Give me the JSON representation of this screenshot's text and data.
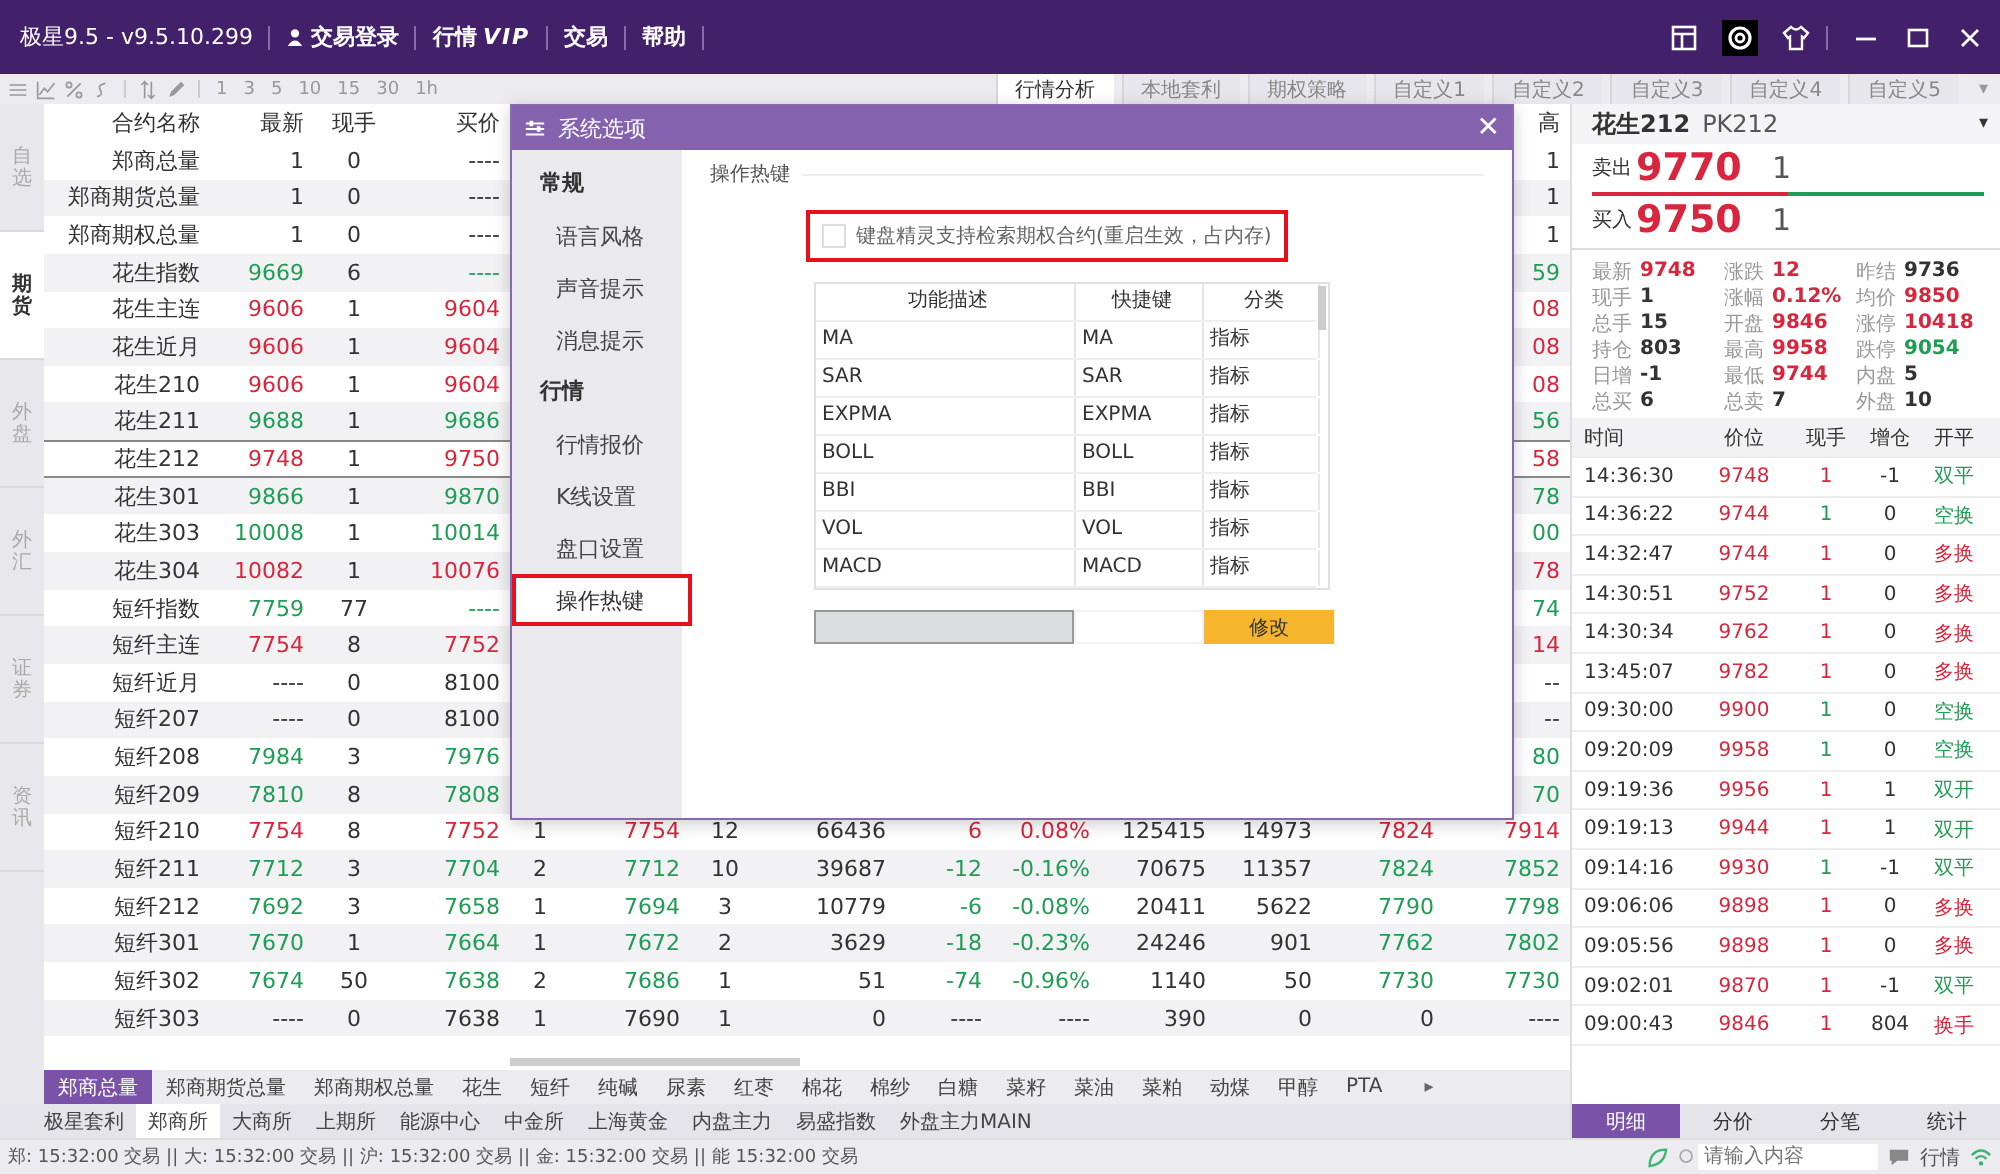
{
  "window": {
    "title": "极星9.5 - v9.5.10.299"
  },
  "menu": [
    {
      "label": "交易登录",
      "kind": "user"
    },
    {
      "label": "行情",
      "badge": "VIP",
      "kind": "vip"
    },
    {
      "label": "交易",
      "kind": "plain"
    },
    {
      "label": "帮助",
      "kind": "plain"
    }
  ],
  "toolbar": {
    "periods": [
      "1",
      "3",
      "5",
      "10",
      "15",
      "30",
      "1h"
    ],
    "tabs": [
      {
        "label": "行情分析",
        "selected": true
      },
      {
        "label": "本地套利",
        "selected": false
      },
      {
        "label": "期权策略",
        "selected": false
      },
      {
        "label": "自定义1",
        "selected": false
      },
      {
        "label": "自定义2",
        "selected": false
      },
      {
        "label": "自定义3",
        "selected": false
      },
      {
        "label": "自定义4",
        "selected": false
      },
      {
        "label": "自定义5",
        "selected": false
      }
    ],
    "more": "▾"
  },
  "side_tabs": [
    {
      "label": "自选",
      "selected": false
    },
    {
      "label": "期货",
      "selected": true
    },
    {
      "label": "外盘",
      "selected": false
    },
    {
      "label": "外汇",
      "selected": false
    },
    {
      "label": "证券",
      "selected": false
    },
    {
      "label": "资讯",
      "selected": false
    }
  ],
  "quote_table": {
    "columns": [
      "合约名称",
      "最新",
      "现手",
      "买价"
    ],
    "column_14": "高",
    "rows": [
      {
        "name": "郑商总量",
        "last": "1",
        "vol": "0",
        "bid": "----",
        "selected": false,
        "edge": "1"
      },
      {
        "name": "郑商期货总量",
        "last": "1",
        "vol": "0",
        "bid": "----",
        "selected": false,
        "edge": "1"
      },
      {
        "name": "郑商期权总量",
        "last": "1",
        "vol": "0",
        "bid": "----",
        "selected": false,
        "edge": "1"
      },
      {
        "name": "花生指数",
        "last": "9669",
        "vol": "6",
        "bid": "----",
        "color": "#1f9d55",
        "selected": false,
        "edge": "59"
      },
      {
        "name": "花生主连",
        "last": "9606",
        "vol": "1",
        "bid": "9604",
        "color": "#d7263d",
        "selected": false,
        "edge": "08"
      },
      {
        "name": "花生近月",
        "last": "9606",
        "vol": "1",
        "bid": "9604",
        "color": "#d7263d",
        "selected": false,
        "edge": "08"
      },
      {
        "name": "花生210",
        "last": "9606",
        "vol": "1",
        "bid": "9604",
        "color": "#d7263d",
        "selected": false,
        "edge": "08"
      },
      {
        "name": "花生211",
        "last": "9688",
        "vol": "1",
        "bid": "9686",
        "color": "#1f9d55",
        "selected": false,
        "edge": "56"
      },
      {
        "name": "花生212",
        "last": "9748",
        "vol": "1",
        "bid": "9750",
        "color": "#d7263d",
        "selected": true,
        "edge": "58"
      },
      {
        "name": "花生301",
        "last": "9866",
        "vol": "1",
        "bid": "9870",
        "color": "#1f9d55",
        "selected": false,
        "edge": "78"
      },
      {
        "name": "花生303",
        "last": "10008",
        "vol": "1",
        "bid": "10014",
        "color": "#1f9d55",
        "selected": false,
        "edge": "00"
      },
      {
        "name": "花生304",
        "last": "10082",
        "vol": "1",
        "bid": "10076",
        "color": "#d7263d",
        "selected": false,
        "edge": "78"
      },
      {
        "name": "短纤指数",
        "last": "7759",
        "vol": "77",
        "bid": "----",
        "color": "#1f9d55",
        "selected": false,
        "edge": "74"
      },
      {
        "name": "短纤主连",
        "last": "7754",
        "vol": "8",
        "bid": "7752",
        "color": "#d7263d",
        "selected": false,
        "edge": "14"
      },
      {
        "name": "短纤近月",
        "last": "----",
        "vol": "0",
        "bid": "8100",
        "selected": false,
        "edge": "--"
      },
      {
        "name": "短纤207",
        "last": "----",
        "vol": "0",
        "bid": "8100",
        "selected": false,
        "edge": "--"
      },
      {
        "name": "短纤208",
        "last": "7984",
        "vol": "3",
        "bid": "7976",
        "color": "#1f9d55",
        "selected": false,
        "edge": "80"
      },
      {
        "name": "短纤209",
        "last": "7810",
        "vol": "8",
        "bid": "7808",
        "color": "#1f9d55",
        "selected": false,
        "edge": "70"
      },
      {
        "name": "短纤210",
        "last": "7754",
        "vol": "8",
        "bid": "7752",
        "color": "#d7263d",
        "selected": false,
        "rest": [
          "1",
          "7754",
          "12",
          "66436",
          "6",
          "0.08%",
          "125415",
          "14973",
          "7824",
          "7914"
        ]
      },
      {
        "name": "短纤211",
        "last": "7712",
        "vol": "3",
        "bid": "7704",
        "color": "#1f9d55",
        "selected": false,
        "rest": [
          "2",
          "7712",
          "10",
          "39687",
          "-12",
          "-0.16%",
          "70675",
          "11357",
          "7824",
          "7852"
        ]
      },
      {
        "name": "短纤212",
        "last": "7692",
        "vol": "3",
        "bid": "7658",
        "color": "#1f9d55",
        "selected": false,
        "rest": [
          "1",
          "7694",
          "3",
          "10779",
          "-6",
          "-0.08%",
          "20411",
          "5622",
          "7790",
          "7798"
        ]
      },
      {
        "name": "短纤301",
        "last": "7670",
        "vol": "1",
        "bid": "7664",
        "color": "#1f9d55",
        "selected": false,
        "rest": [
          "1",
          "7672",
          "2",
          "3629",
          "-18",
          "-0.23%",
          "24246",
          "901",
          "7762",
          "7802"
        ]
      },
      {
        "name": "短纤302",
        "last": "7674",
        "vol": "50",
        "bid": "7638",
        "color": "#1f9d55",
        "selected": false,
        "rest": [
          "2",
          "7686",
          "1",
          "51",
          "-74",
          "-0.96%",
          "1140",
          "50",
          "7730",
          "7730"
        ]
      },
      {
        "name": "短纤303",
        "last": "----",
        "vol": "0",
        "bid": "7638",
        "selected": false,
        "rest": [
          "1",
          "7690",
          "1",
          "0",
          "----",
          "----",
          "390",
          "0",
          "0",
          "----"
        ]
      }
    ]
  },
  "category_tabs": [
    {
      "label": "郑商总量",
      "selected": true
    },
    {
      "label": "郑商期货总量",
      "selected": false
    },
    {
      "label": "郑商期权总量",
      "selected": false
    },
    {
      "label": "花生",
      "selected": false
    },
    {
      "label": "短纤",
      "selected": false
    },
    {
      "label": "纯碱",
      "selected": false
    },
    {
      "label": "尿素",
      "selected": false
    },
    {
      "label": "红枣",
      "selected": false
    },
    {
      "label": "棉花",
      "selected": false
    },
    {
      "label": "棉纱",
      "selected": false
    },
    {
      "label": "白糖",
      "selected": false
    },
    {
      "label": "菜籽",
      "selected": false
    },
    {
      "label": "菜油",
      "selected": false
    },
    {
      "label": "菜粕",
      "selected": false
    },
    {
      "label": "动煤",
      "selected": false
    },
    {
      "label": "甲醇",
      "selected": false
    },
    {
      "label": "PTA",
      "selected": false
    }
  ],
  "category_more": "▸",
  "exchange_tabs": [
    {
      "label": "极星套利",
      "selected": false
    },
    {
      "label": "郑商所",
      "selected": true
    },
    {
      "label": "大商所",
      "selected": false
    },
    {
      "label": "上期所",
      "selected": false
    },
    {
      "label": "能源中心",
      "selected": false
    },
    {
      "label": "中金所",
      "selected": false
    },
    {
      "label": "上海黄金",
      "selected": false
    },
    {
      "label": "内盘主力",
      "selected": false
    },
    {
      "label": "易盛指数",
      "selected": false
    },
    {
      "label": "外盘主力MAIN",
      "selected": false
    }
  ],
  "dialog": {
    "title": "系统选项",
    "close": "✕",
    "nav": [
      {
        "label": "常规",
        "kind": "group"
      },
      {
        "label": "语言风格",
        "kind": "item",
        "selected": false,
        "highlighted": false
      },
      {
        "label": "声音提示",
        "kind": "item",
        "selected": false,
        "highlighted": false
      },
      {
        "label": "消息提示",
        "kind": "item",
        "selected": false,
        "highlighted": false
      },
      {
        "label": "行情",
        "kind": "group"
      },
      {
        "label": "行情报价",
        "kind": "item",
        "selected": false,
        "highlighted": false
      },
      {
        "label": "K线设置",
        "kind": "item",
        "selected": false,
        "highlighted": false
      },
      {
        "label": "盘口设置",
        "kind": "item",
        "selected": false,
        "highlighted": false
      },
      {
        "label": "操作热键",
        "kind": "item",
        "selected": true,
        "highlighted": true
      }
    ],
    "section": "操作热键",
    "option": {
      "label": "键盘精灵支持检索期权合约(重启生效，占内存)",
      "checked": false,
      "highlighted": true
    },
    "hotkeys": {
      "columns": [
        "功能描述",
        "快捷键",
        "分类"
      ],
      "rows": [
        [
          "MA",
          "MA",
          "指标"
        ],
        [
          "SAR",
          "SAR",
          "指标"
        ],
        [
          "EXPMA",
          "EXPMA",
          "指标"
        ],
        [
          "BOLL",
          "BOLL",
          "指标"
        ],
        [
          "BBI",
          "BBI",
          "指标"
        ],
        [
          "VOL",
          "VOL",
          "指标"
        ],
        [
          "MACD",
          "MACD",
          "指标"
        ]
      ]
    },
    "button": "修改"
  },
  "detail": {
    "name": "花生212",
    "code": "PK212",
    "dropdown": "▾",
    "ask": {
      "label": "卖出",
      "price": "9770",
      "qty": "1"
    },
    "bid": {
      "label": "买入",
      "price": "9750",
      "qty": "1"
    },
    "stats": [
      {
        "label": "最新",
        "value": "9748",
        "color": "#d7263d"
      },
      {
        "label": "涨跌",
        "value": "12",
        "color": "#d7263d"
      },
      {
        "label": "昨结",
        "value": "9736",
        "color": "#333333"
      },
      {
        "label": "现手",
        "value": "1",
        "color": "#333333"
      },
      {
        "label": "涨幅",
        "value": "0.12%",
        "color": "#d7263d"
      },
      {
        "label": "均价",
        "value": "9850",
        "color": "#d7263d"
      },
      {
        "label": "总手",
        "value": "15",
        "color": "#333333"
      },
      {
        "label": "开盘",
        "value": "9846",
        "color": "#d7263d"
      },
      {
        "label": "涨停",
        "value": "10418",
        "color": "#d7263d"
      },
      {
        "label": "持仓",
        "value": "803",
        "color": "#333333"
      },
      {
        "label": "最高",
        "value": "9958",
        "color": "#d7263d"
      },
      {
        "label": "跌停",
        "value": "9054",
        "color": "#1f9d55"
      },
      {
        "label": "日增",
        "value": "-1",
        "color": "#333333"
      },
      {
        "label": "最低",
        "value": "9744",
        "color": "#d7263d"
      },
      {
        "label": "内盘",
        "value": "5",
        "color": "#333333"
      },
      {
        "label": "总买",
        "value": "6",
        "color": "#333333"
      },
      {
        "label": "总卖",
        "value": "7",
        "color": "#333333"
      },
      {
        "label": "外盘",
        "value": "10",
        "color": "#333333"
      }
    ],
    "tick_columns": [
      "时间",
      "价位",
      "现手",
      "增仓",
      "开平"
    ],
    "ticks": [
      {
        "time": "14:36:30",
        "price": "9748",
        "vol": {
          "value": "1",
          "color": "#d7263d"
        },
        "oi": "-1",
        "action": "双平",
        "color": "#1f9d55"
      },
      {
        "time": "14:36:22",
        "price": "9744",
        "vol": {
          "value": "1",
          "color": "#1f9d55"
        },
        "oi": "0",
        "action": "空换",
        "color": "#1f9d55"
      },
      {
        "time": "14:32:47",
        "price": "9744",
        "vol": {
          "value": "1",
          "color": "#d7263d"
        },
        "oi": "0",
        "action": "多换",
        "color": "#d7263d"
      },
      {
        "time": "14:30:51",
        "price": "9752",
        "vol": {
          "value": "1",
          "color": "#d7263d"
        },
        "oi": "0",
        "action": "多换",
        "color": "#d7263d"
      },
      {
        "time": "14:30:34",
        "price": "9762",
        "vol": {
          "value": "1",
          "color": "#d7263d"
        },
        "oi": "0",
        "action": "多换",
        "color": "#d7263d"
      },
      {
        "time": "13:45:07",
        "price": "9782",
        "vol": {
          "value": "1",
          "color": "#d7263d"
        },
        "oi": "0",
        "action": "多换",
        "color": "#d7263d"
      },
      {
        "time": "09:30:00",
        "price": "9900",
        "vol": {
          "value": "1",
          "color": "#1f9d55"
        },
        "oi": "0",
        "action": "空换",
        "color": "#1f9d55"
      },
      {
        "time": "09:20:09",
        "price": "9958",
        "vol": {
          "value": "1",
          "color": "#1f9d55"
        },
        "oi": "0",
        "action": "空换",
        "color": "#1f9d55"
      },
      {
        "time": "09:19:36",
        "price": "9956",
        "vol": {
          "value": "1",
          "color": "#d7263d"
        },
        "oi": "1",
        "action": "双开",
        "color": "#1f9d55"
      },
      {
        "time": "09:19:13",
        "price": "9944",
        "vol": {
          "value": "1",
          "color": "#d7263d"
        },
        "oi": "1",
        "action": "双开",
        "color": "#1f9d55"
      },
      {
        "time": "09:14:16",
        "price": "9930",
        "vol": {
          "value": "1",
          "color": "#1f9d55"
        },
        "oi": "-1",
        "action": "双平",
        "color": "#1f9d55"
      },
      {
        "time": "09:06:06",
        "price": "9898",
        "vol": {
          "value": "1",
          "color": "#d7263d"
        },
        "oi": "0",
        "action": "多换",
        "color": "#d7263d"
      },
      {
        "time": "09:05:56",
        "price": "9898",
        "vol": {
          "value": "1",
          "color": "#d7263d"
        },
        "oi": "0",
        "action": "多换",
        "color": "#d7263d"
      },
      {
        "time": "09:02:01",
        "price": "9870",
        "vol": {
          "value": "1",
          "color": "#d7263d"
        },
        "oi": "-1",
        "action": "双平",
        "color": "#1f9d55"
      },
      {
        "time": "09:00:43",
        "price": "9846",
        "vol": {
          "value": "1",
          "color": "#d7263d"
        },
        "oi": "804",
        "action": "换手",
        "color": "#d7263d"
      }
    ],
    "tabs": [
      {
        "label": "明细",
        "selected": true
      },
      {
        "label": "分价",
        "selected": false
      },
      {
        "label": "分笔",
        "selected": false
      },
      {
        "label": "统计",
        "selected": false
      }
    ]
  },
  "status_bar": {
    "text": "郑: 15:32:00 交易 || 大: 15:32:00 交易 || 沪: 15:32:00 交易 || 金: 15:32:00 交易 || 能 15:32:00 交易",
    "search_placeholder": "请输入内容",
    "connection": "行情"
  }
}
